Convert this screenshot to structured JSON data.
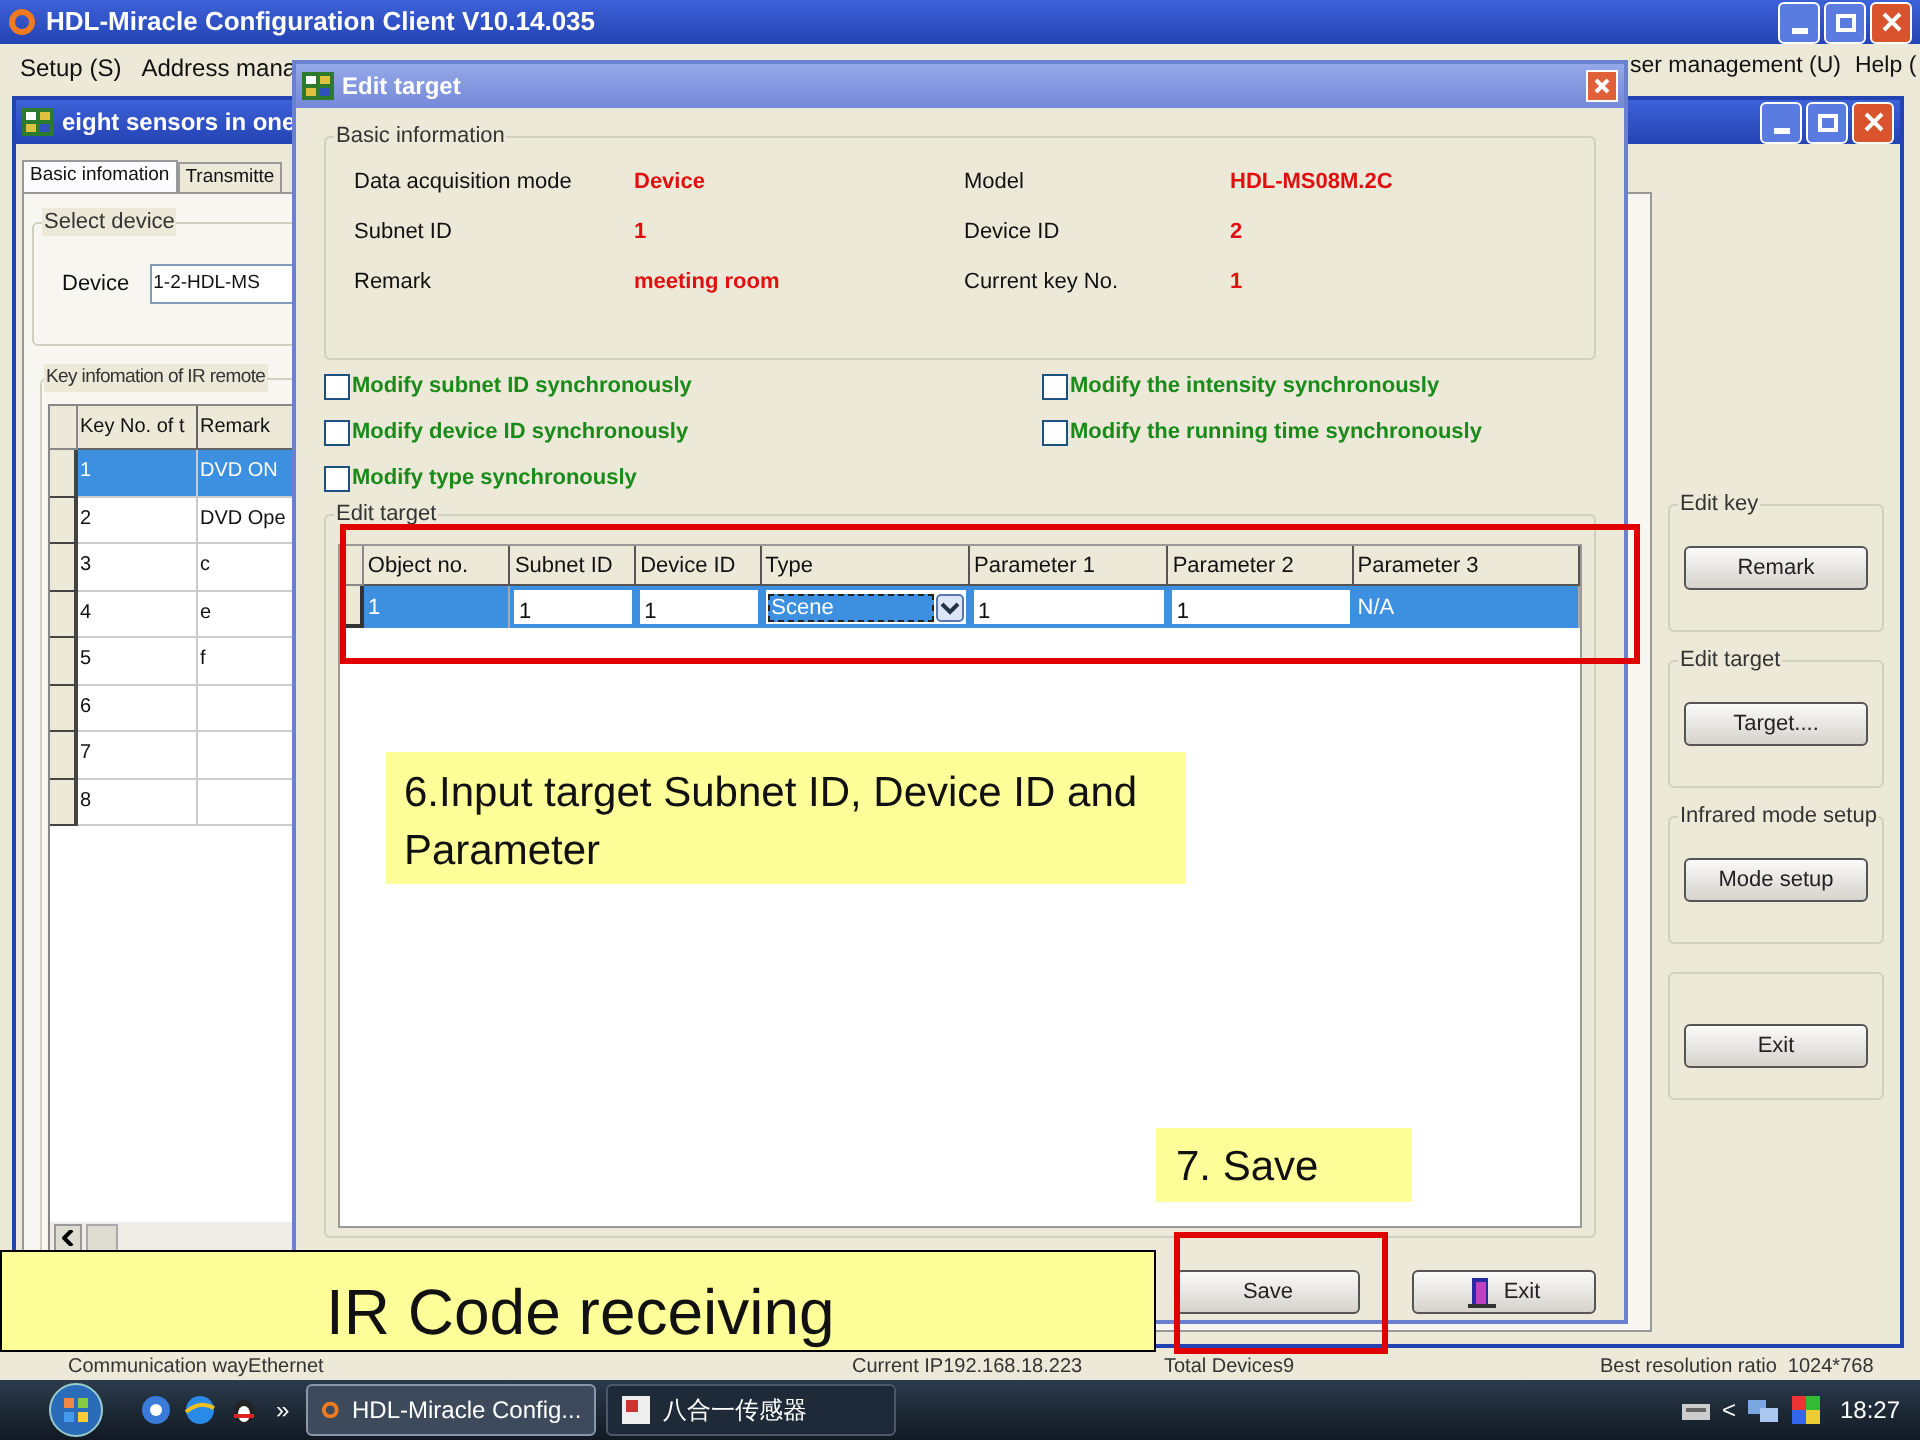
{
  "app_window": {
    "title": "HDL-Miracle Configuration Client V10.14.035",
    "menu_left": [
      "Setup (S)",
      "Address mana"
    ],
    "menu_right": [
      "ser management (U)",
      "Help ("
    ]
  },
  "child_window": {
    "title": "eight sensors in one",
    "tabs": [
      {
        "label": "Basic infomation",
        "selected": true
      },
      {
        "label": "Transmitte",
        "selected": false
      }
    ],
    "select_device": {
      "title": "Select device",
      "label": "Device",
      "value": "1-2-HDL-MS"
    },
    "key_table": {
      "title": "Key infomation of IR remote",
      "columns": [
        "Key No. of t",
        "Remark"
      ],
      "rows": [
        {
          "cells": [
            "1",
            "DVD ON"
          ],
          "selected": true
        },
        {
          "cells": [
            "2",
            "DVD Ope"
          ],
          "selected": false
        },
        {
          "cells": [
            "3",
            "c"
          ],
          "selected": false
        },
        {
          "cells": [
            "4",
            "e"
          ],
          "selected": false
        },
        {
          "cells": [
            "5",
            "f"
          ],
          "selected": false
        },
        {
          "cells": [
            "6",
            ""
          ],
          "selected": false
        },
        {
          "cells": [
            "7",
            ""
          ],
          "selected": false
        },
        {
          "cells": [
            "8",
            ""
          ],
          "selected": false
        }
      ]
    },
    "side_groups": [
      {
        "title": "Edit key",
        "button": "Remark"
      },
      {
        "title": "Edit target",
        "button": "Target...."
      },
      {
        "title": "Infrared mode setup",
        "button": "Mode setup"
      },
      {
        "button": "Exit"
      }
    ]
  },
  "dialog": {
    "title": "Edit target",
    "basic_info": {
      "title": "Basic information",
      "fields": [
        {
          "label": "Data acquisition mode",
          "value": "Device"
        },
        {
          "label": "Model",
          "value": "HDL-MS08M.2C"
        },
        {
          "label": "Subnet ID",
          "value": "1"
        },
        {
          "label": "Device ID",
          "value": "2"
        },
        {
          "label": "Remark",
          "value": "meeting room"
        },
        {
          "label": "Current key No.",
          "value": "1"
        }
      ]
    },
    "checkboxes": [
      {
        "label": "Modify subnet ID synchronously",
        "checked": false
      },
      {
        "label": "Modify the intensity synchronously",
        "checked": false
      },
      {
        "label": "Modify device ID synchronously",
        "checked": false
      },
      {
        "label": "Modify the running time synchronously",
        "checked": false
      },
      {
        "label": "Modify type synchronously",
        "checked": false
      }
    ],
    "edit_target": {
      "title": "Edit target",
      "columns": [
        "Object no.",
        "Subnet ID",
        "Device ID",
        "Type",
        "Parameter 1",
        "Parameter 2",
        "Parameter 3"
      ],
      "row": {
        "selected": true,
        "cells": [
          {
            "kind": "text",
            "value": "1"
          },
          {
            "kind": "input",
            "value": "1"
          },
          {
            "kind": "input",
            "value": "1"
          },
          {
            "kind": "combo",
            "value": "Scene"
          },
          {
            "kind": "input",
            "value": "1"
          },
          {
            "kind": "input",
            "value": "1"
          },
          {
            "kind": "text",
            "value": "N/A"
          }
        ]
      }
    },
    "buttons": [
      {
        "kind": "plain",
        "label": "Save"
      },
      {
        "kind": "icon",
        "label": "Exit"
      }
    ]
  },
  "annotations": [
    {
      "text": "6.Input target Subnet ID, Device ID and Parameter"
    },
    {
      "text": "7. Save"
    },
    {
      "text": "IR Code receiving"
    }
  ],
  "status_bar": [
    "Communication wayEthernet",
    "Current IP192.168.18.223",
    "Total Devices9",
    "Best resolution ratio  1024*768"
  ],
  "taskbar": {
    "overflow": "»",
    "tasks": [
      {
        "label": "HDL-Miracle Config...",
        "selected": true
      },
      {
        "label": "八合一传感器",
        "selected": false
      }
    ],
    "tray_arrow": "<",
    "clock": "18:27"
  }
}
